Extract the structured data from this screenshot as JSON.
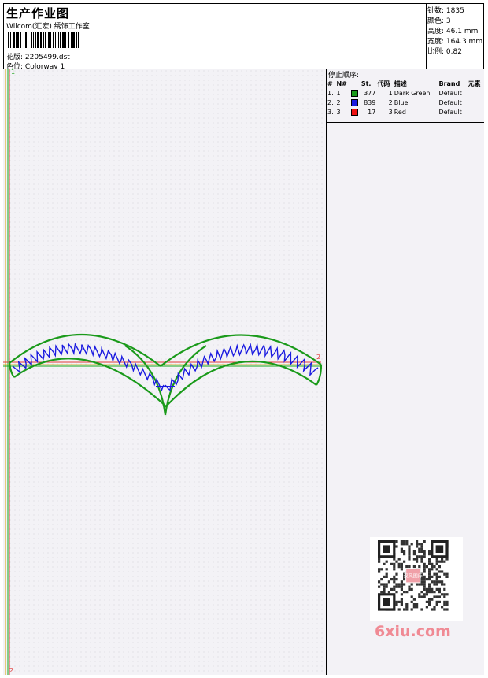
{
  "header": {
    "title": "生产作业图",
    "subtitle": "Wilcom(汇宏) 绣饰工作室",
    "design_label": "花版:",
    "design_value": "2205499.dst",
    "colorway_label": "色位:",
    "colorway_value": "Colorway 1"
  },
  "stats": [
    {
      "label": "针数:",
      "value": "1835"
    },
    {
      "label": "颜色:",
      "value": "3"
    },
    {
      "label": "高度:",
      "value": "46.1 mm"
    },
    {
      "label": "宽度:",
      "value": "164.3 mm"
    },
    {
      "label": "比例:",
      "value": "0.82"
    }
  ],
  "stop_sequence": {
    "title": "停止顺序:",
    "columns": [
      "#",
      "N#",
      "St.",
      "代码",
      "描述",
      "Brand",
      "元素"
    ],
    "rows": [
      {
        "idx": "1.",
        "n": "1",
        "color": "#1a9a1a",
        "stitches": "377",
        "code": "1",
        "desc": "Dark Green",
        "brand": "Default"
      },
      {
        "idx": "2.",
        "n": "2",
        "color": "#1a1ae0",
        "stitches": "839",
        "code": "2",
        "desc": "Blue",
        "brand": "Default"
      },
      {
        "idx": "3.",
        "n": "3",
        "color": "#ee1111",
        "stitches": "17",
        "code": "3",
        "desc": "Red",
        "brand": "Default"
      }
    ]
  },
  "markers": {
    "start_top": "1",
    "end_right": "2",
    "end_bottom": "2"
  },
  "watermark": {
    "text": "6xiu.com",
    "badge": "汉风图库"
  }
}
